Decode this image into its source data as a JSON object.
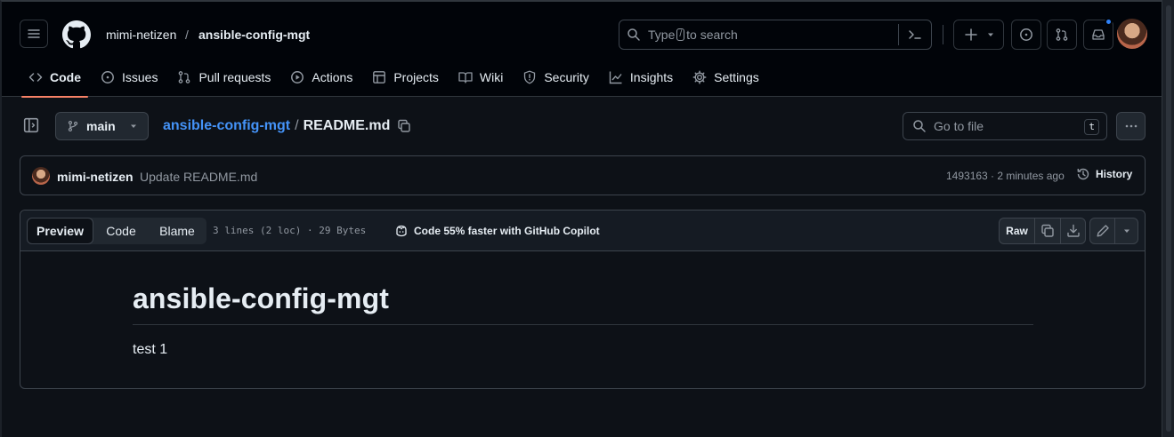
{
  "header": {
    "owner": "mimi-netizen",
    "separator": "/",
    "repo": "ansible-config-mgt",
    "search": {
      "prefix": "Type",
      "key": "/",
      "suffix": "to search"
    }
  },
  "tabs": [
    {
      "label": "Code",
      "icon": "code-icon",
      "selected": true
    },
    {
      "label": "Issues",
      "icon": "issue-icon"
    },
    {
      "label": "Pull requests",
      "icon": "pull-request-icon"
    },
    {
      "label": "Actions",
      "icon": "play-icon"
    },
    {
      "label": "Projects",
      "icon": "table-icon"
    },
    {
      "label": "Wiki",
      "icon": "book-icon"
    },
    {
      "label": "Security",
      "icon": "shield-icon"
    },
    {
      "label": "Insights",
      "icon": "graph-icon"
    },
    {
      "label": "Settings",
      "icon": "gear-icon"
    }
  ],
  "filebar": {
    "branch": "main",
    "repo_link": "ansible-config-mgt",
    "slash": "/",
    "filename": "README.md",
    "goto_placeholder": "Go to file",
    "goto_key": "t"
  },
  "commit": {
    "author": "mimi-netizen",
    "message": "Update README.md",
    "meta": "1493163 · 2 minutes ago",
    "history": "History"
  },
  "file": {
    "views": [
      "Preview",
      "Code",
      "Blame"
    ],
    "lines": "3 lines (2 loc) · 29 Bytes",
    "copilot": "Code 55% faster with GitHub Copilot",
    "raw": "Raw"
  },
  "readme": {
    "heading": "ansible-config-mgt",
    "body": "test 1"
  },
  "colors": {
    "accent_tab": "#f78166",
    "link": "#4493f8",
    "notification": "#2f81f7"
  }
}
